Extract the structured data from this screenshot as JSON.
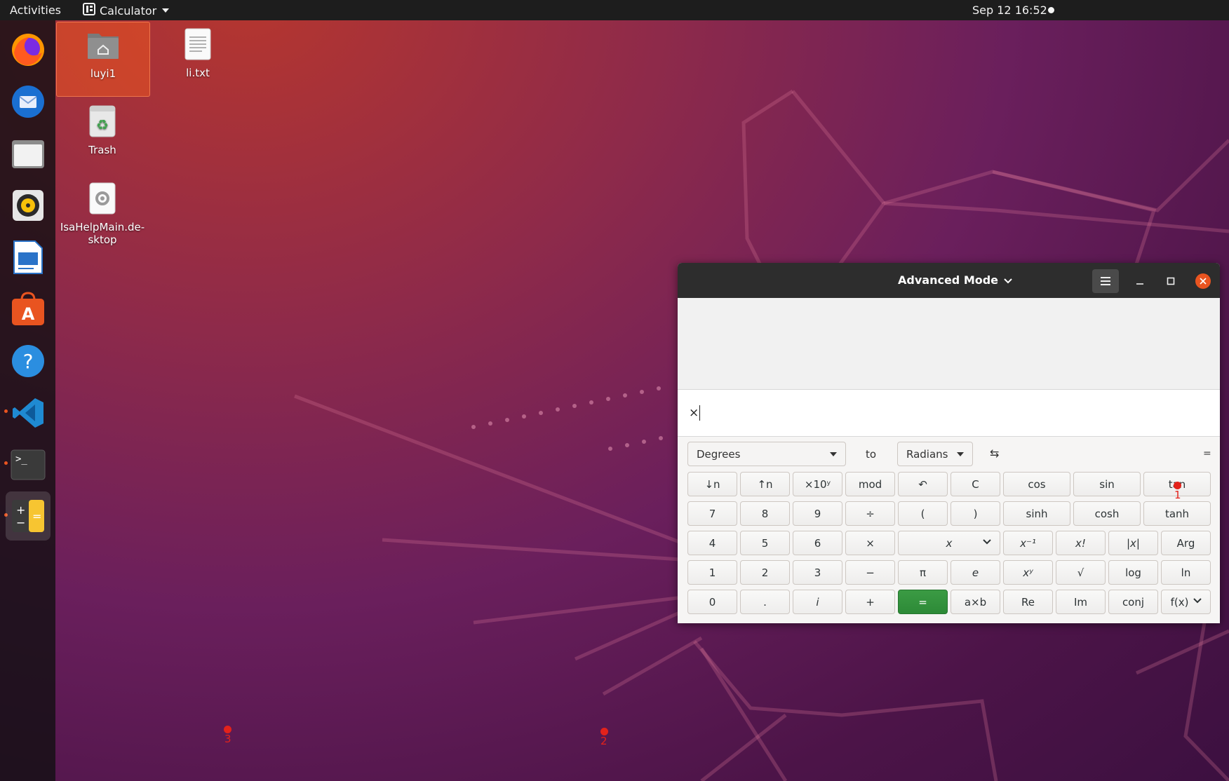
{
  "topbar": {
    "activities": "Activities",
    "app_name": "Calculator",
    "clock": "Sep 12  16:52"
  },
  "desktop": {
    "icons": [
      {
        "label": "luyi1"
      },
      {
        "label": "li.txt"
      },
      {
        "label": "Trash"
      },
      {
        "label": "IsaHelpMain.de-sktop"
      }
    ]
  },
  "window": {
    "title": "Advanced Mode",
    "display_text": "×"
  },
  "conversion": {
    "from_unit": "Degrees",
    "to_label": "to",
    "to_unit": "Radians",
    "swap_symbol": "⇆",
    "equals_symbol": "="
  },
  "keys": {
    "row1": [
      "↓n",
      "↑n",
      "×10ʸ",
      "mod",
      "↶",
      "C",
      "cos",
      "sin",
      "tan"
    ],
    "row2": [
      "7",
      "8",
      "9",
      "÷",
      "(",
      ")",
      "sinh",
      "cosh",
      "tanh"
    ],
    "row3": [
      "4",
      "5",
      "6",
      "×",
      "x",
      "x⁻¹",
      "x!",
      "|x|",
      "Arg"
    ],
    "row4": [
      "1",
      "2",
      "3",
      "−",
      "π",
      "e",
      "xʸ",
      "√",
      "log",
      "ln"
    ],
    "row5": [
      "0",
      ".",
      "i",
      "+",
      "=",
      "a×b",
      "Re",
      "Im",
      "conj",
      "f(x)"
    ]
  },
  "markers": [
    "1",
    "2",
    "3"
  ],
  "colors": {
    "accent": "#e95420",
    "equals_key": "#2d8a37",
    "topbar": "#1d1d1d",
    "marker": "#e3221b"
  }
}
